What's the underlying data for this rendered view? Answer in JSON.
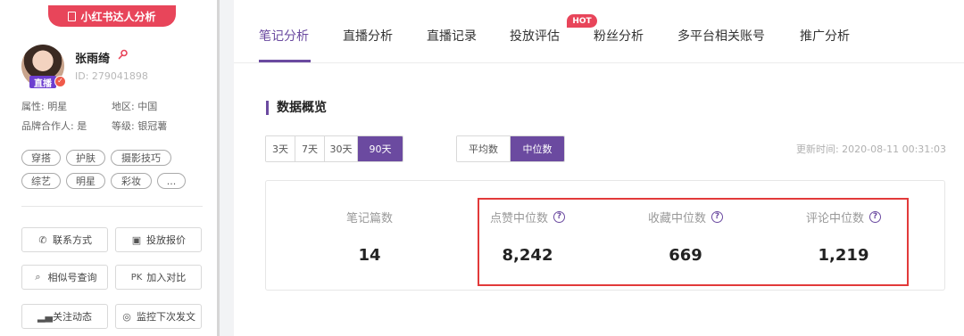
{
  "sidebar": {
    "brand_label": "小红书达人分析",
    "profile": {
      "name": "张雨绮",
      "id_text": "ID: 279041898",
      "live_tag": "直播"
    },
    "info": {
      "attribute": "属性: 明星",
      "region": "地区: 中国",
      "brand_partner": "品牌合作人: 是",
      "level": "等级: 银冠薯"
    },
    "tags": [
      "穿搭",
      "护肤",
      "摄影技巧",
      "综艺",
      "明星",
      "彩妆",
      "..."
    ],
    "buttons": {
      "contact": "联系方式",
      "quote": "投放报价",
      "similar": "相似号查询",
      "compare": "加入对比",
      "follow": "关注动态",
      "monitor": "监控下次发文"
    },
    "button_icons": {
      "contact": "phone-icon",
      "quote": "price-icon",
      "similar": "search-icon",
      "compare": "pk-icon",
      "follow": "bars-icon",
      "monitor": "monitor-icon"
    }
  },
  "main": {
    "tabs": [
      {
        "label": "笔记分析",
        "active": true
      },
      {
        "label": "直播分析",
        "active": false
      },
      {
        "label": "直播记录",
        "active": false
      },
      {
        "label": "投放评估",
        "active": false
      },
      {
        "label": "粉丝分析",
        "active": false
      },
      {
        "label": "多平台相关账号",
        "active": false
      },
      {
        "label": "推广分析",
        "active": false
      }
    ],
    "hot_badge": "HOT",
    "section_title": "数据概览",
    "range_options": [
      "3天",
      "7天",
      "30天",
      "90天"
    ],
    "range_selected": "90天",
    "stat_mode_options": [
      "平均数",
      "中位数"
    ],
    "stat_mode_selected": "中位数",
    "update_time": "更新时间: 2020-08-11 00:31:03",
    "stats": [
      {
        "label": "笔记篇数",
        "value": "14",
        "help": false
      },
      {
        "label": "点赞中位数",
        "value": "8,242",
        "help": true
      },
      {
        "label": "收藏中位数",
        "value": "669",
        "help": true
      },
      {
        "label": "评论中位数",
        "value": "1,219",
        "help": true
      }
    ]
  },
  "colors": {
    "accent": "#6b4aa0",
    "brand_red": "#e8455a",
    "highlight_red": "#e23a3a"
  }
}
